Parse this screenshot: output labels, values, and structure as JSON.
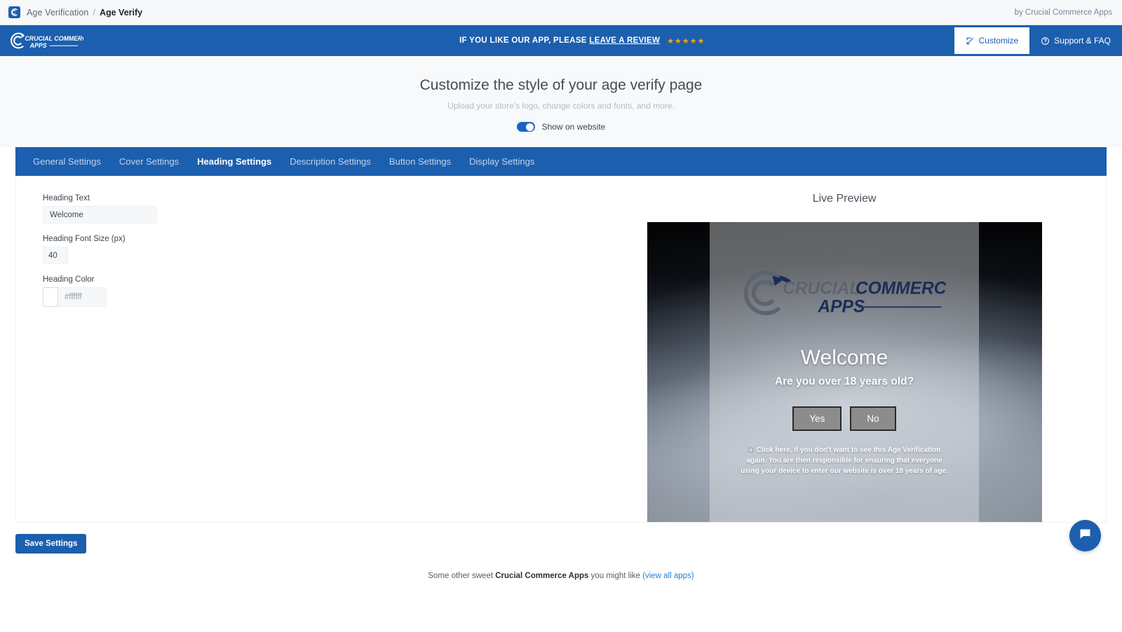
{
  "breadcrumb": {
    "logo_icon": "crucial-c-logo-icon",
    "parent": "Age Verification",
    "separator": "/",
    "current": "Age Verify",
    "byline": "by Crucial Commerce Apps"
  },
  "app_header": {
    "brand_line1": "CRUCIAL COMMERCE",
    "brand_line2": "APPS",
    "review_prefix": "IF YOU LIKE OUR APP, PLEASE",
    "review_link": "LEAVE A REVIEW",
    "stars": "★★★★★",
    "star_count": 5,
    "star_color": "#f2a81d",
    "customize_label": "Customize",
    "customize_icon": "edit-square-icon",
    "support_label": "Support & FAQ",
    "support_icon": "question-circle-icon",
    "background_color": "#1c5fae"
  },
  "page": {
    "title": "Customize the style of your age verify page",
    "subtitle": "Upload your store's logo, change colors and fonts, and more.",
    "toggle_label": "Show on website",
    "toggle_on": true
  },
  "tabs": [
    {
      "label": "General Settings",
      "active": false
    },
    {
      "label": "Cover Settings",
      "active": false
    },
    {
      "label": "Heading Settings",
      "active": true
    },
    {
      "label": "Description Settings",
      "active": false
    },
    {
      "label": "Button Settings",
      "active": false
    },
    {
      "label": "Display Settings",
      "active": false
    }
  ],
  "form": {
    "heading_text_label": "Heading Text",
    "heading_text_value": "Welcome",
    "heading_text_placeholder": "Welcome",
    "font_size_label": "Heading Font Size (px)",
    "font_size_value": "40",
    "color_label": "Heading Color",
    "color_value": "#ffffff",
    "color_swatch": "#ffffff"
  },
  "preview": {
    "title": "Live Preview",
    "brand_line1": "CRUCIAL COMMERCE",
    "brand_line2": "APPS",
    "heading": "Welcome",
    "subheading": "Are you over 18 years old?",
    "yes_label": "Yes",
    "no_label": "No",
    "checkbox_text": "Click here, if you don't want to see this Age Verification again. You are then responsible for ensuring that everyone using your device to enter our website is over 18 years of age.",
    "button_bg": "#8c8c8c",
    "button_text_color": "#ffffff"
  },
  "actions": {
    "save_label": "Save Settings"
  },
  "footer": {
    "prefix": "Some other sweet",
    "brand": "Crucial Commerce Apps",
    "middle": "you might like",
    "link": "(view all apps)"
  },
  "chat": {
    "icon": "chat-bubble-icon"
  }
}
